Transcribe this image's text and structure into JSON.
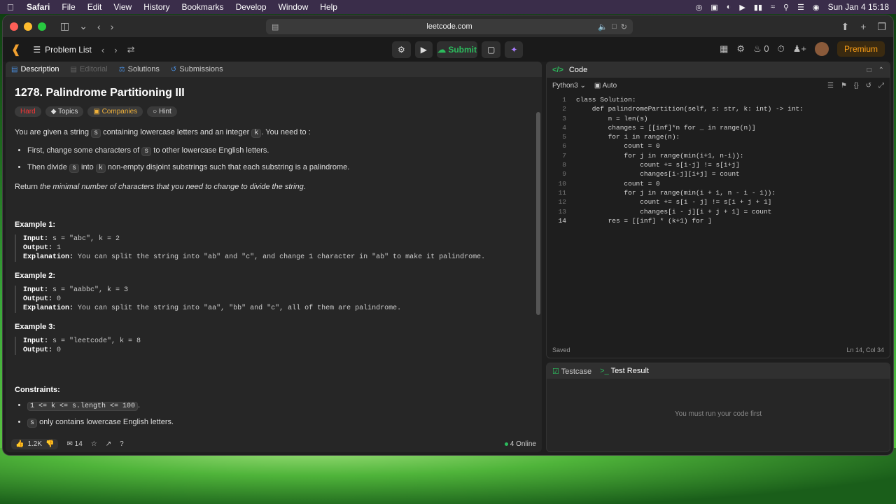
{
  "menubar": {
    "app": "Safari",
    "items": [
      "File",
      "Edit",
      "View",
      "History",
      "Bookmarks",
      "Develop",
      "Window",
      "Help"
    ],
    "datetime": "Sun Jan 4  15:18"
  },
  "browser": {
    "url": "leetcode.com"
  },
  "lc_header": {
    "problem_list": "Problem List",
    "submit": "Submit",
    "fire_count": "0",
    "premium": "Premium"
  },
  "left_tabs": {
    "description": "Description",
    "editorial": "Editorial",
    "solutions": "Solutions",
    "submissions": "Submissions"
  },
  "problem": {
    "title": "1278. Palindrome Partitioning III",
    "tags": {
      "difficulty": "Hard",
      "topics": "Topics",
      "companies": "Companies",
      "hint": "Hint"
    },
    "intro_1": "You are given a string ",
    "intro_s": "s",
    "intro_2": " containing lowercase letters and an integer ",
    "intro_k": "k",
    "intro_3": ". You need to :",
    "bullet1_a": "First, change some characters of ",
    "bullet1_s": "s",
    "bullet1_b": " to other lowercase English letters.",
    "bullet2_a": "Then divide ",
    "bullet2_s": "s",
    "bullet2_b": " into ",
    "bullet2_k": "k",
    "bullet2_c": " non-empty disjoint substrings such that each substring is a palindrome.",
    "return_a": "Return ",
    "return_b": "the minimal number of characters that you need to change to divide the string",
    "return_c": ".",
    "examples": [
      {
        "title": "Example 1:",
        "input": "s = \"abc\", k = 2",
        "output": "1",
        "explanation": "You can split the string into \"ab\" and \"c\", and change 1 character in \"ab\" to make it palindrome."
      },
      {
        "title": "Example 2:",
        "input": "s = \"aabbc\", k = 3",
        "output": "0",
        "explanation": "You can split the string into \"aa\", \"bb\" and \"c\", all of them are palindrome."
      },
      {
        "title": "Example 3:",
        "input": "s = \"leetcode\", k = 8",
        "output": "0"
      }
    ],
    "input_label": "Input:",
    "output_label": "Output:",
    "explanation_label": "Explanation:",
    "constraints_title": "Constraints:",
    "constraint1": "1 <= k <= s.length <= 100",
    "constraint1_suffix": ".",
    "constraint2_s": "s",
    "constraint2": " only contains lowercase English letters."
  },
  "left_footer": {
    "likes": "1.2K",
    "comments": "14",
    "online": "4 Online"
  },
  "code_panel": {
    "title": "Code",
    "language": "Python3",
    "auto": "Auto",
    "lines": [
      "class Solution:",
      "    def palindromePartition(self, s: str, k: int) -> int:",
      "        n = len(s)",
      "        changes = [[inf]*n for _ in range(n)]",
      "        for i in range(n):",
      "            count = 0",
      "            for j in range(min(i+1, n-i)):",
      "                count += s[i-j] != s[i+j]",
      "                changes[i-j][i+j] = count",
      "            count = 0",
      "            for j in range(min(i + 1, n - i - 1)):",
      "                count += s[i - j] != s[i + j + 1]",
      "                changes[i - j][i + j + 1] = count",
      "        res = [[inf] * (k+1) for ]"
    ],
    "status": "Saved",
    "cursor": "Ln 14, Col 34"
  },
  "test_panel": {
    "testcase": "Testcase",
    "test_result": "Test Result",
    "message": "You must run your code first"
  }
}
